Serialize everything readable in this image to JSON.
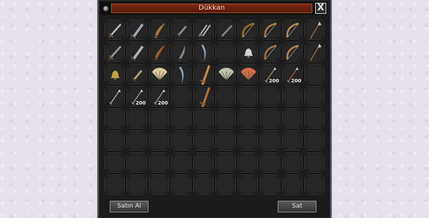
{
  "window": {
    "title": "Dükkan",
    "close_label": "X"
  },
  "grid": {
    "columns": 10,
    "rows": 8
  },
  "items": [
    {
      "row": 0,
      "col": 0,
      "icon": "sword-icon",
      "color": "#b8b8b8"
    },
    {
      "row": 0,
      "col": 1,
      "icon": "broadsword-icon",
      "color": "#9fa7b0"
    },
    {
      "row": 0,
      "col": 2,
      "icon": "scimitar-icon",
      "color": "#a0793e"
    },
    {
      "row": 0,
      "col": 3,
      "icon": "dagger-icon",
      "color": "#8f8f8f"
    },
    {
      "row": 0,
      "col": 4,
      "icon": "twin-blades-icon",
      "color": "#aab3bb"
    },
    {
      "row": 0,
      "col": 5,
      "icon": "blade-icon",
      "color": "#7d858c"
    },
    {
      "row": 0,
      "col": 6,
      "icon": "bow-icon",
      "color": "#a06a28"
    },
    {
      "row": 0,
      "col": 7,
      "icon": "bow-icon",
      "color": "#b07a3a"
    },
    {
      "row": 0,
      "col": 8,
      "icon": "bow-icon",
      "color": "#c2884a"
    },
    {
      "row": 0,
      "col": 9,
      "icon": "spear-icon",
      "color": "#c9c9c9"
    },
    {
      "row": 1,
      "col": 0,
      "icon": "sword-icon",
      "color": "#a0a0a0"
    },
    {
      "row": 1,
      "col": 1,
      "icon": "broadsword-icon",
      "color": "#b4b4b4"
    },
    {
      "row": 1,
      "col": 2,
      "icon": "scimitar-icon",
      "color": "#9b5a2a"
    },
    {
      "row": 1,
      "col": 3,
      "icon": "knife-icon",
      "color": "#8a8a8a"
    },
    {
      "row": 1,
      "col": 4,
      "icon": "curved-blade-icon",
      "color": "#8aa0b6"
    },
    {
      "row": 1,
      "col": 6,
      "icon": "bell-icon",
      "color": "#d2d2d2"
    },
    {
      "row": 1,
      "col": 7,
      "icon": "bow-icon",
      "color": "#a87038"
    },
    {
      "row": 1,
      "col": 8,
      "icon": "bow-icon",
      "color": "#b88448"
    },
    {
      "row": 1,
      "col": 9,
      "icon": "spear-icon",
      "color": "#d0d0d0"
    },
    {
      "row": 2,
      "col": 0,
      "icon": "bell-icon",
      "color": "#c9a444"
    },
    {
      "row": 2,
      "col": 1,
      "icon": "dagger-icon",
      "color": "#b9a47a"
    },
    {
      "row": 2,
      "col": 2,
      "icon": "fan-icon",
      "color": "#d9caa0"
    },
    {
      "row": 2,
      "col": 3,
      "icon": "curved-blade-icon",
      "color": "#8aa0b6"
    },
    {
      "row": 2,
      "col": 4,
      "icon": "great-sword-icon",
      "color": "#c98a46"
    },
    {
      "row": 2,
      "col": 5,
      "icon": "fan-icon",
      "color": "#b9c4a8"
    },
    {
      "row": 2,
      "col": 6,
      "icon": "fan-icon",
      "color": "#d86c4a"
    },
    {
      "row": 2,
      "col": 7,
      "icon": "arrow-icon",
      "color": "#b08850",
      "qty": "200"
    },
    {
      "row": 2,
      "col": 8,
      "icon": "arrow-icon",
      "color": "#b0502a",
      "qty": "200"
    },
    {
      "row": 3,
      "col": 0,
      "icon": "arrow-icon",
      "color": "#b0b0b0"
    },
    {
      "row": 3,
      "col": 1,
      "icon": "arrow-icon",
      "color": "#9aa0a6",
      "qty": "200"
    },
    {
      "row": 3,
      "col": 2,
      "icon": "arrow-icon",
      "color": "#a0a0a0",
      "qty": "200"
    },
    {
      "row": 3,
      "col": 4,
      "icon": "great-sword-icon",
      "color": "#b07038"
    }
  ],
  "buttons": {
    "buy": "Satın Al",
    "sell": "Sat"
  }
}
